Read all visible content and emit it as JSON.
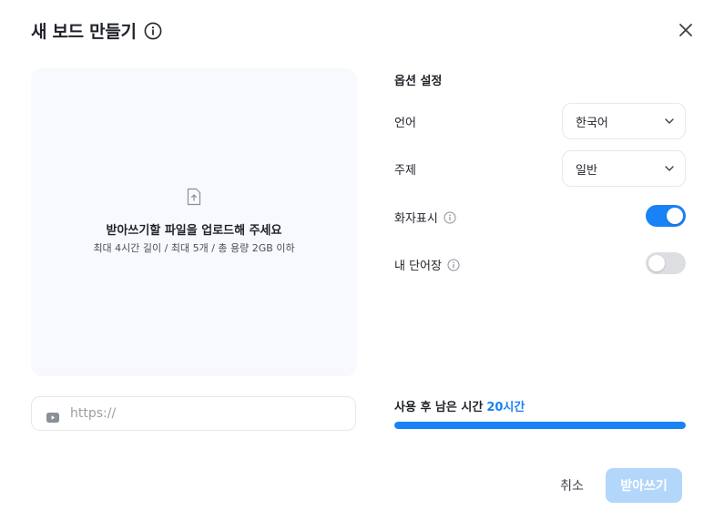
{
  "dialog": {
    "title": "새 보드 만들기",
    "title_info_icon": "info-circle-icon",
    "close_icon": "close-icon"
  },
  "upload": {
    "icon": "file-upload-icon",
    "title": "받아쓰기할 파일을 업로드해 주세요",
    "subtitle": "최대 4시간 길이 / 최대 5개 / 총 용량 2GB 이하"
  },
  "url_input": {
    "icon": "youtube-icon",
    "placeholder": "https://",
    "value": ""
  },
  "options": {
    "heading": "옵션 설정",
    "language": {
      "label": "언어",
      "selected": "한국어"
    },
    "topic": {
      "label": "주제",
      "selected": "일반"
    },
    "speaker_display": {
      "label": "화자표시",
      "enabled": true
    },
    "my_vocabulary": {
      "label": "내 단어장",
      "enabled": false
    }
  },
  "remaining": {
    "label": "사용 후 남은 시간",
    "value": "20시간",
    "progress": 1.0
  },
  "footer": {
    "cancel_label": "취소",
    "submit_label": "받아쓰기",
    "submit_disabled": true
  },
  "colors": {
    "accent": "#1a82f7",
    "accent_disabled": "#b3d6fb",
    "toggle_off": "#dcdee2",
    "dropzone_bg": "#f7f9fc"
  }
}
